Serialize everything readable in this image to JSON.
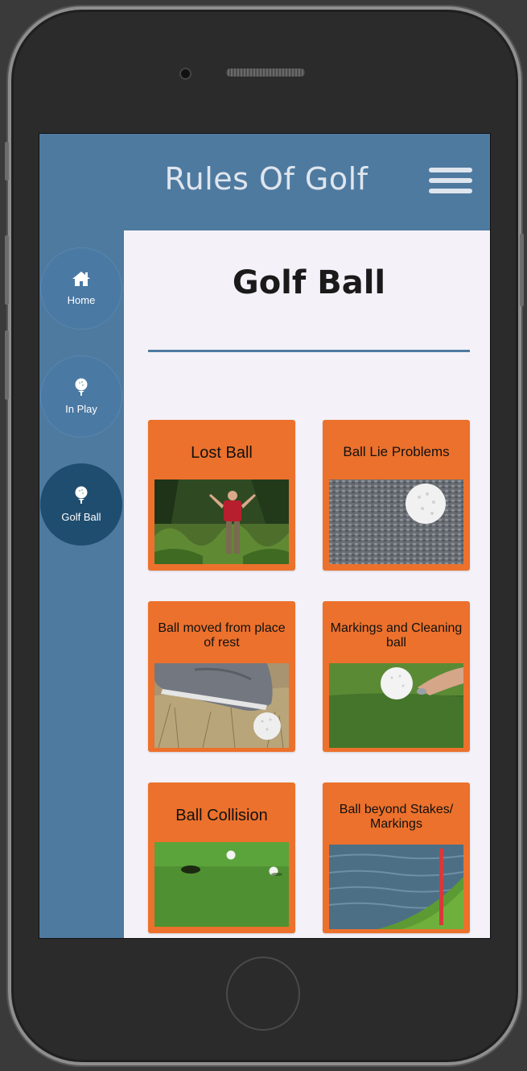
{
  "header": {
    "title": "Rules Of Golf"
  },
  "sidebar": {
    "items": [
      {
        "label": "Home",
        "icon": "home-icon"
      },
      {
        "label": "In Play",
        "icon": "golf-ball-tee-icon"
      },
      {
        "label": "Golf Ball",
        "icon": "golf-ball-tee-icon"
      }
    ]
  },
  "main": {
    "title": "Golf Ball",
    "cards": [
      {
        "title": "Lost Ball"
      },
      {
        "title": "Ball Lie Problems"
      },
      {
        "title": "Ball moved from place of rest"
      },
      {
        "title": "Markings and Cleaning ball"
      },
      {
        "title": "Ball Collision"
      },
      {
        "title": "Ball beyond Stakes/ Markings"
      }
    ]
  },
  "colors": {
    "header": "#4f7aa0",
    "active_nav": "#1e4d6f",
    "card": "#ec712c",
    "content_bg": "#f4f2f8"
  }
}
